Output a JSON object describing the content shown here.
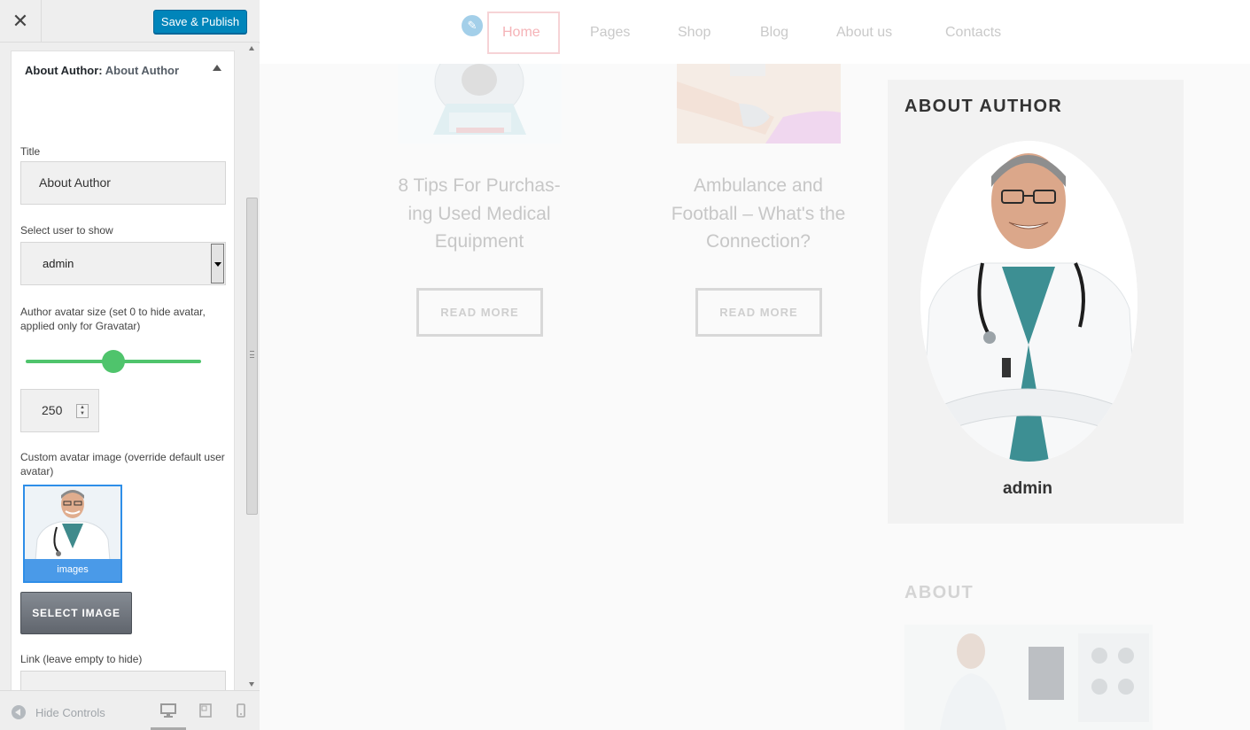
{
  "customizer": {
    "close_icon": "close-icon",
    "publish_label": "Save & Publish",
    "section": {
      "title_prefix": "About Author:",
      "title_name": "About Author"
    },
    "fields": {
      "title_label": "Title",
      "title_value": "About Author",
      "user_label": "Select user to show",
      "user_value": "admin",
      "avatar_size_label": "Author avatar size (set 0 to hide avatar, applied only for Gravatar)",
      "avatar_size_value": "250",
      "avatar_size_fraction": 0.5,
      "custom_avatar_label": "Custom avatar image (override default user avatar)",
      "avatar_caption": "images",
      "select_image_label": "SELECT IMAGE",
      "link_label": "Link (leave empty to hide)",
      "link_value": ""
    },
    "footer": {
      "hide_controls_label": "Hide Controls",
      "devices": [
        "desktop-icon",
        "tablet-icon",
        "mobile-icon"
      ],
      "active_device": "desktop"
    }
  },
  "preview": {
    "nav": {
      "items": [
        "Home",
        "Pages",
        "Shop",
        "Blog",
        "About us",
        "Contacts"
      ],
      "active": "Home"
    },
    "posts": [
      {
        "title": "8 Tips For Purchas-ing Used Medical Equipment",
        "button": "READ MORE"
      },
      {
        "title": "Ambulance and Football – What's the Connection?",
        "button": "READ MORE"
      }
    ],
    "widget_author": {
      "title": "ABOUT AUTHOR",
      "name": "admin"
    },
    "about_widget": {
      "title": "ABOUT"
    }
  },
  "colors": {
    "publish_button": "#0085ba",
    "slider": "#4fc46c",
    "selected_image_border": "#2e8ee8",
    "nav_active": "#f5b3b7"
  }
}
